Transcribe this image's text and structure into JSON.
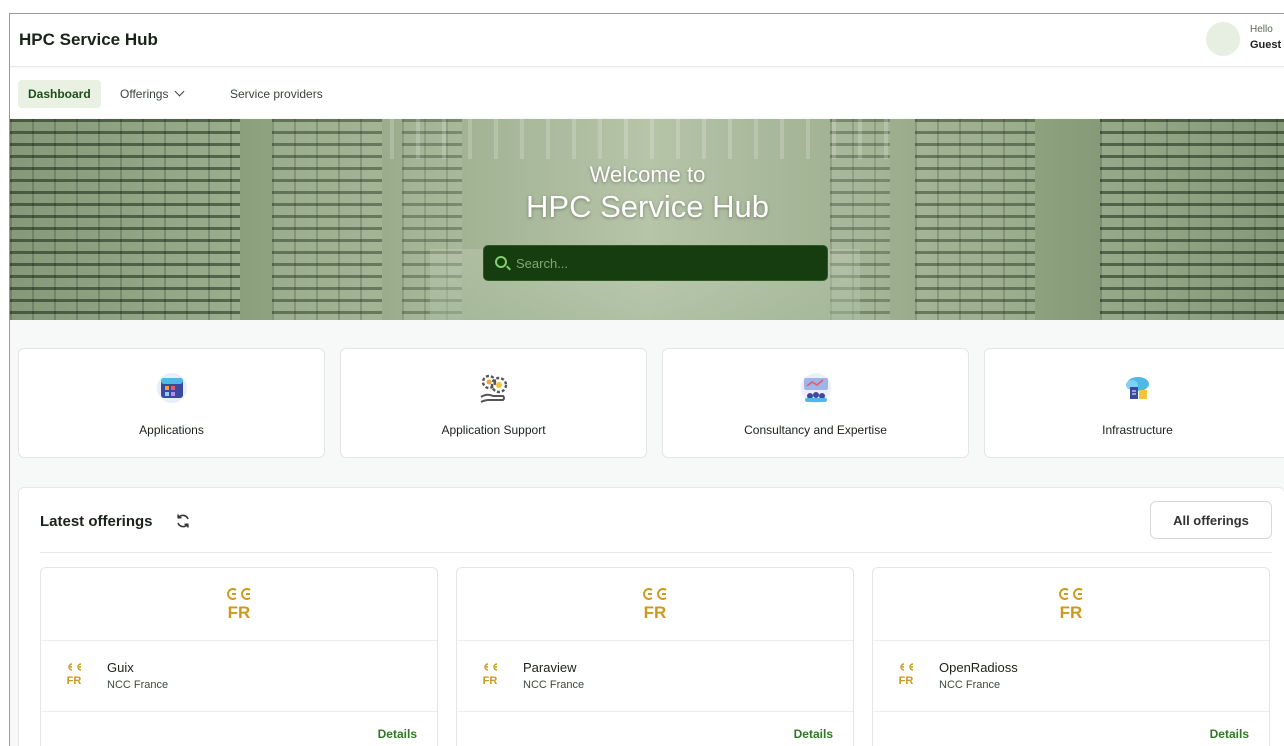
{
  "header": {
    "brand": "HPC Service Hub",
    "greeting": "Hello",
    "user": "Guest"
  },
  "nav": {
    "items": [
      {
        "label": "Dashboard",
        "active": true
      },
      {
        "label": "Offerings",
        "active": false,
        "has_dropdown": true
      },
      {
        "label": "Service providers",
        "active": false
      }
    ]
  },
  "hero": {
    "line1": "Welcome to",
    "line2": "HPC Service Hub",
    "search_placeholder": "Search..."
  },
  "categories": [
    {
      "label": "Applications",
      "icon": "applications-icon"
    },
    {
      "label": "Application Support",
      "icon": "application-support-icon"
    },
    {
      "label": "Consultancy and Expertise",
      "icon": "consultancy-icon"
    },
    {
      "label": "Infrastructure",
      "icon": "infrastructure-icon"
    }
  ],
  "latest": {
    "title": "Latest offerings",
    "all_button": "All offerings",
    "cards": [
      {
        "name": "Guix",
        "provider": "NCC France",
        "details": "Details",
        "logo_text": "FR"
      },
      {
        "name": "Paraview",
        "provider": "NCC France",
        "details": "Details",
        "logo_text": "FR"
      },
      {
        "name": "OpenRadioss",
        "provider": "NCC France",
        "details": "Details",
        "logo_text": "FR"
      }
    ]
  },
  "colors": {
    "accent": "#2f7a23",
    "search_bg": "#163d10",
    "logo_gold": "#c99a1e",
    "nav_active_bg": "#e9f1e3"
  }
}
